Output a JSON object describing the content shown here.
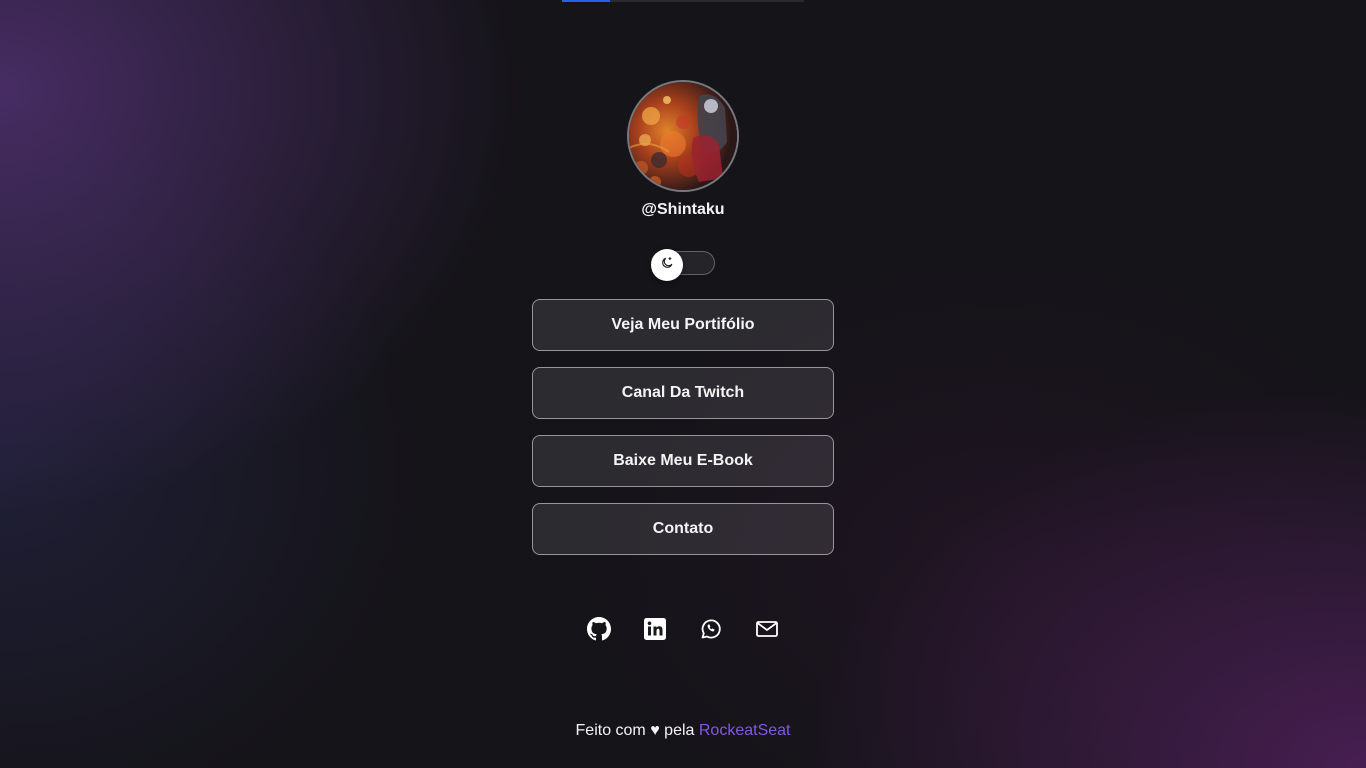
{
  "top_progress": {
    "percent": 20,
    "track_color": "#2a2930",
    "fill_color": "#2563eb"
  },
  "profile": {
    "username": "@Shintaku",
    "avatar_alt": "Avatar"
  },
  "theme_toggle": {
    "icon": "moon-icon",
    "state": "off"
  },
  "links": [
    {
      "label": "Veja Meu Portifólio"
    },
    {
      "label": "Canal Da Twitch"
    },
    {
      "label": "Baixe Meu E-Book"
    },
    {
      "label": "Contato"
    }
  ],
  "social": [
    {
      "icon": "github-icon"
    },
    {
      "icon": "linkedin-icon"
    },
    {
      "icon": "whatsapp-icon"
    },
    {
      "icon": "mail-icon"
    }
  ],
  "footer": {
    "prefix": "Feito com",
    "heart": "♥",
    "middle": "pela",
    "link_text": "RockeatSeat",
    "link_color": "#8257e5"
  }
}
